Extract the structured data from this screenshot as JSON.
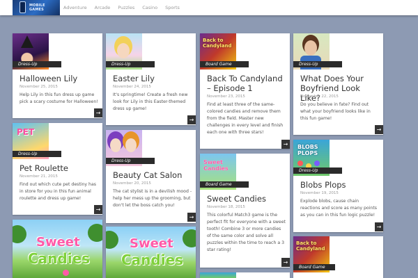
{
  "header": {
    "logo_alt_text": "MOBILE GAMES",
    "nav": [
      "Adventure",
      "Arcade",
      "Puzzles",
      "Casino",
      "Sports"
    ]
  },
  "cards": [
    {
      "title": "Halloween Lily",
      "category": "Dress-Up",
      "date": "November 25, 2015",
      "description": "Help Lily in this fun dress up game pick a scary costume for Halloween!"
    },
    {
      "title": "Easter Lily",
      "category": "Dress-Up",
      "date": "November 24, 2015",
      "description": "It's springtime! Create a fresh new look for Lily in this Easter-themed dress up game!"
    },
    {
      "title": "Back To Candyland – Episode 1",
      "category": "Board Game",
      "date": "November 23, 2015",
      "description": "Find at least three of the same-colored candies and remove them from the field. Master new challenges in every level and finish each one with three stars!"
    },
    {
      "title": "What Does Your Boyfriend Look Like?",
      "category": "Dress-Up",
      "date": "November 22, 2015",
      "description": "Do you believe in fate? Find out what your boyfriend looks like in this fun game!"
    },
    {
      "title": "Pet Roulette",
      "category": "Dress-Up",
      "date": "November 21, 2015",
      "description": "Find out which cute pet destiny has in store for you in this fun animal roulette and dress up game!"
    },
    {
      "title": "Beauty Cat Salon",
      "category": "Dress-Up",
      "date": "November 20, 2015",
      "description": "The cat stylist is in a devilish mood - help her mess up the grooming, but don't let the boss catch you!"
    },
    {
      "title": "Sweet Candies",
      "category": "Board Game",
      "date": "November 18, 2015",
      "description": "This colorful Match3 game is the perfect fit for everyone with a sweet tooth! Combine 3 or more candies of the same color and solve all puzzles within the time to reach a 3 star rating!"
    },
    {
      "title": "Blobs Plops",
      "category": "Dress-Up",
      "date": "November 19, 2015",
      "description": "Explode blobs, cause chain reactions and score as many points as you can in this fun logic puzzle!"
    },
    {
      "title": "",
      "category": "Board Game",
      "date": "",
      "description": ""
    }
  ],
  "thumb_text": {
    "candyland": "Back to Candyland",
    "pet": "PET",
    "sweet": "Sweet Candies",
    "blobs": "BLOBS PLOPS",
    "big_sweet_1": "Sweet",
    "big_sweet_2": "Candies"
  },
  "more_glyph": "→"
}
